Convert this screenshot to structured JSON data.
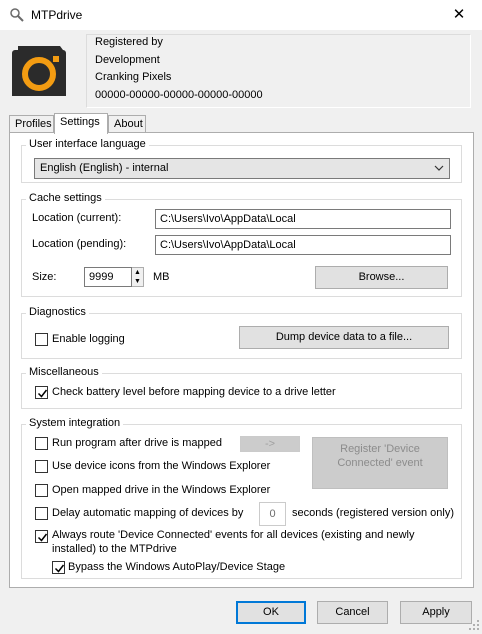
{
  "window": {
    "title": "MTPdrive"
  },
  "registration": {
    "line1": "Registered by",
    "line2": "Development",
    "line3": "Cranking Pixels",
    "line4": "00000-00000-00000-00000-00000"
  },
  "tabs": [
    {
      "label": "Profiles"
    },
    {
      "label": "Settings"
    },
    {
      "label": "About"
    }
  ],
  "ui_language": {
    "title": "User interface language",
    "selected": "English (English) - internal"
  },
  "cache": {
    "title": "Cache settings",
    "current_label": "Location (current):",
    "current_value": "C:\\Users\\Ivo\\AppData\\Local",
    "pending_label": "Location (pending):",
    "pending_value": "C:\\Users\\Ivo\\AppData\\Local",
    "size_label": "Size:",
    "size_value": "9999",
    "size_unit": "MB",
    "browse_label": "Browse..."
  },
  "diagnostics": {
    "title": "Diagnostics",
    "enable_logging": "Enable logging",
    "enable_logging_checked": false,
    "dump_label": "Dump device data to a file..."
  },
  "misc": {
    "title": "Miscellaneous",
    "check_battery": "Check battery level before mapping device to a drive letter",
    "check_battery_checked": true
  },
  "system": {
    "title": "System integration",
    "run_program": "Run program after drive is mapped",
    "run_program_checked": false,
    "run_program_button": "->",
    "register_button": "Register 'Device Connected' event",
    "use_icons": "Use device icons from the Windows Explorer",
    "use_icons_checked": false,
    "open_mapped": "Open mapped drive in the Windows Explorer",
    "open_mapped_checked": false,
    "delay_label": "Delay automatic mapping of devices by",
    "delay_checked": false,
    "delay_value": "0",
    "delay_suffix": "seconds (registered version only)",
    "always_route_line1": "Always route 'Device Connected' events for all devices (existing and newly",
    "always_route_line2": "installed) to the MTPdrive",
    "always_route_checked": true,
    "bypass": "Bypass the Windows AutoPlay/Device Stage",
    "bypass_checked": true
  },
  "footer": {
    "ok": "OK",
    "cancel": "Cancel",
    "apply": "Apply"
  },
  "colors": {
    "accent": "#0078d7",
    "logo_orange": "#f39c12",
    "logo_dark": "#2b2b2b"
  }
}
